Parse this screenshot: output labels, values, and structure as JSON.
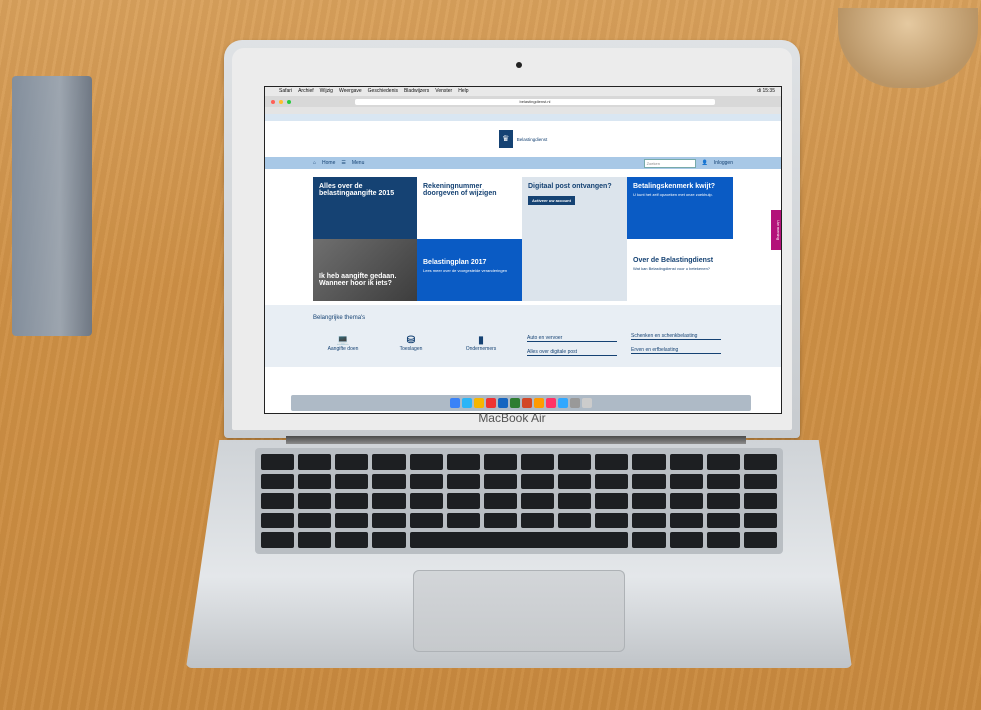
{
  "scene": {
    "device_label": "MacBook Air"
  },
  "browser": {
    "menu": [
      "Safari",
      "Archief",
      "Wijzig",
      "Weergave",
      "Geschiedenis",
      "Bladwijzers",
      "Venster",
      "Help"
    ],
    "clock": "di 15:35",
    "address": "belastingdienst.nl"
  },
  "site": {
    "logo_text": "Belastingdienst",
    "nav_home": "Home",
    "nav_menu": "Menu",
    "search_placeholder": "Zoeken",
    "login": "Inloggen",
    "tiles": [
      {
        "title": "Alles over de belastingaangifte 2015",
        "sub": ""
      },
      {
        "title": "Rekeningnummer doorgeven of wijzigen",
        "sub": ""
      },
      {
        "title": "Digitaal post ontvangen?",
        "sub": "",
        "button": "Activeer uw account"
      },
      {
        "title": "Betalingskenmerk kwijt?",
        "sub": "U kunt het zelf opzoeken met onze zoekhulp."
      },
      {
        "title": "Ik heb aangifte gedaan. Wanneer hoor ik iets?",
        "sub": ""
      },
      {
        "title": "Belastingplan 2017",
        "sub": "Lees meer over de voorgestelde veranderingen"
      },
      {
        "title": "Over de Belastingdienst",
        "sub": "Wat kan Belastingdienst voor u betekenen?"
      }
    ],
    "side_tab": "Uw mening",
    "themes_title": "Belangrijke thema's",
    "theme_icons": [
      "Aangifte doen",
      "Toeslagen",
      "Ondernemers"
    ],
    "theme_links": [
      "Auto en vervoer",
      "Alles over digitale post",
      "Schenken en schenkbelasting",
      "Erven en erfbelasting"
    ]
  }
}
